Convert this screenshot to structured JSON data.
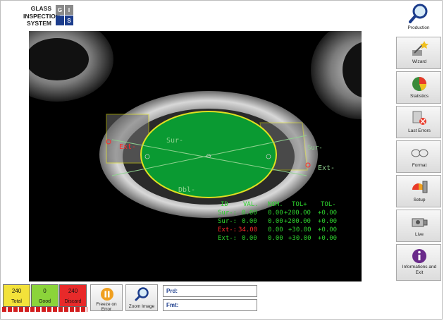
{
  "logo": {
    "line1": "GLASS",
    "line2": "INSPECTION",
    "line3": "SYSTEM",
    "letters": [
      "G",
      "I",
      "",
      "S"
    ]
  },
  "view": {
    "annotations": {
      "sur_top": "Sur-",
      "sur_right": "Sur-",
      "ext_left": "Ext-",
      "ext_right": "Ext-",
      "dbl": "Dbl-"
    },
    "table": {
      "headers": [
        "ID",
        "VAL.",
        "NOM.",
        "TOL+",
        "TOL-"
      ],
      "rows": [
        {
          "id": "Sur-:",
          "val": "0.00",
          "nom": "0.00",
          "tolp": "+200.00",
          "tolm": "+0.00",
          "status": "ok"
        },
        {
          "id": "Sur-:",
          "val": "0.00",
          "nom": "0.00",
          "tolp": "+200.00",
          "tolm": "+0.00",
          "status": "ok"
        },
        {
          "id": "Ext-:",
          "val": "34.00",
          "nom": "0.00",
          "tolp": "+30.00",
          "tolm": "+0.00",
          "status": "error"
        },
        {
          "id": "Ext-:",
          "val": "0.00",
          "nom": "0.00",
          "tolp": "+30.00",
          "tolm": "+0.00",
          "status": "ok"
        }
      ]
    }
  },
  "toolbar": {
    "production": "Production",
    "wizard": "Wizard",
    "statistics": "Statistics",
    "last_errors": "Last Errors",
    "format": "Format",
    "setup": "Setup",
    "live": "Live",
    "info_line1": "Informations and",
    "info_line2": "Exit"
  },
  "bottom": {
    "counters": [
      {
        "value": "240",
        "label": "Total",
        "color": "#f3e23a"
      },
      {
        "value": "0",
        "label": "Good",
        "color": "#8bd43a"
      },
      {
        "value": "240",
        "label": "Discard",
        "color": "#e82a2a"
      }
    ],
    "freeze_line1": "Freeze on",
    "freeze_line2": "Error",
    "zoom": "Zoom Image",
    "prd_label": "Prd:",
    "fmt_label": "Fmt:",
    "prd_value": "",
    "fmt_value": ""
  },
  "colors": {
    "accent": "#1c3d8c",
    "ok_text": "#2dd12d",
    "error_text": "#ff2a2a",
    "overlay_green": "#0a9a32",
    "overlay_yellow": "#e0e020"
  }
}
